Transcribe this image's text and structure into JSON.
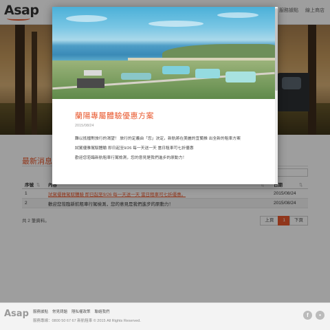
{
  "header": {
    "logo": "Asap",
    "nav": [
      "服務據點",
      "線上商店"
    ]
  },
  "news": {
    "section_title": "最新消息",
    "columns": {
      "no": "序號",
      "content": "內容",
      "date": "日期"
    },
    "rows": [
      {
        "no": "1",
        "content": "試駕優雅駕馭體驗 即日起至9/26 每一天送一天 當日租車可七折優惠。",
        "date": "2015/08/24",
        "linked": true
      },
      {
        "no": "2",
        "content": "歡迎您蒞臨新航租車行駕檢測，您的意見是我們進步的原動力！",
        "date": "2015/08/24",
        "linked": false
      }
    ],
    "total": "共 2 筆資料。",
    "pager": {
      "prev": "上頁",
      "current": "1",
      "next": "下頁"
    }
  },
  "footer": {
    "logo": "Asap",
    "links": [
      "服務據點",
      "常見問題",
      "隱私權政策",
      "聯絡我們"
    ],
    "copyright": "服務專線：0800 50 67 67 新航租車 © 2015 All Rights Reserved.",
    "icons": [
      "facebook-icon",
      "line-icon"
    ]
  },
  "modal": {
    "title": "蘭陽專屬體驗優惠方案",
    "date": "2015/08/24",
    "paragraphs": [
      "難以抵擋對旅行的渴望！ 旅行的定義由「您」決定，新航將在美麗的宜蘭推 出全新的租車方案",
      "試駕優雅駕馭體驗 即日起至9/26 每一天送一天 當日租車可七折優惠",
      "歡迎您蒞臨新航租車行駕檢測，您的意見是我們進步的原動力！"
    ]
  },
  "colors": {
    "accent": "#e8572c",
    "overlay": "rgba(0,0,0,0.38)"
  }
}
